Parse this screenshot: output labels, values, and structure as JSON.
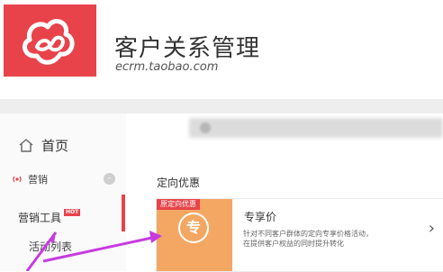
{
  "app": {
    "title": "客户关系管理",
    "url": "ecrm.taobao.com"
  },
  "sidebar": {
    "home_label": "首页",
    "marketing_label": "营销",
    "collapse_symbol": "–",
    "tools_label": "营销工具",
    "tools_badge": "HOT",
    "activity_label": "活动列表"
  },
  "main": {
    "section_title": "定向优惠",
    "card": {
      "ribbon": "原定向优惠",
      "icon_char": "专",
      "name": "专享价",
      "desc_line1": "针对不同客户群体的定向专享价格活动，",
      "desc_line2": "在提供客户权益的同时提升转化",
      "arrow": "›"
    }
  },
  "colors": {
    "brand_red": "#e8434a",
    "card_orange": "#f4a762",
    "annotation_purple": "#c73be0"
  },
  "icons": [
    "cloud-logo-icon",
    "home-icon",
    "marketing-broadcast-icon",
    "chevron-right-icon"
  ]
}
